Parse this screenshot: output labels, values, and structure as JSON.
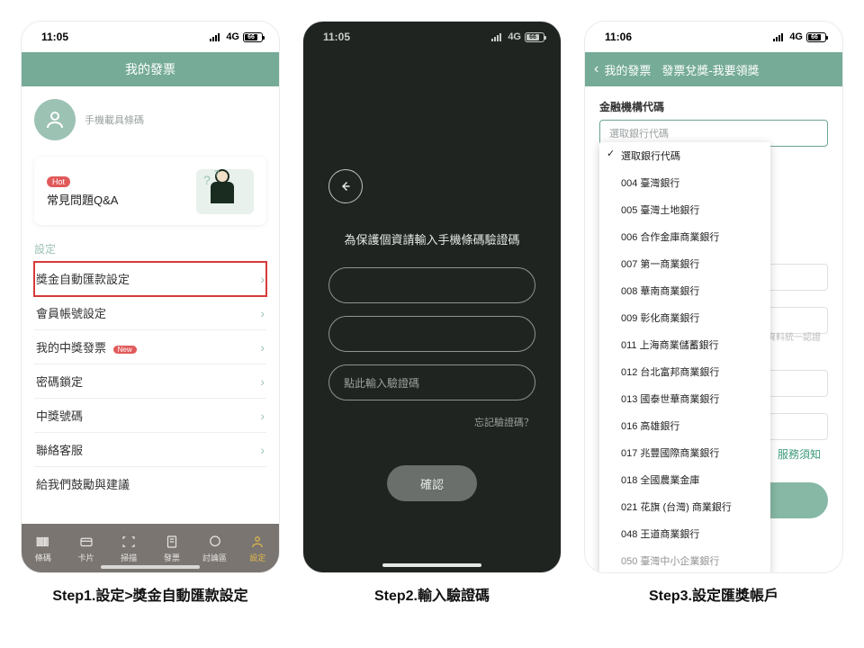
{
  "status": {
    "time1": "11:05",
    "time2": "11:05",
    "time3": "11:06",
    "net": "4G",
    "batt": "66"
  },
  "p1": {
    "header": "我的發票",
    "profile_label": "手機載具條碼",
    "hot": "Hot",
    "qa_title": "常見問題Q&A",
    "section": "設定",
    "rows": [
      "獎金自動匯款設定",
      "會員帳號設定",
      "我的中獎發票",
      "密碼鎖定",
      "中獎號碼",
      "聯絡客服",
      "給我們鼓勵與建議"
    ],
    "new": "New",
    "tabs": [
      "條碼",
      "卡片",
      "掃描",
      "發票",
      "討論區",
      "設定"
    ]
  },
  "p2": {
    "msg": "為保護個資請輸入手機條碼驗證碼",
    "field3_placeholder": "點此輸入驗證碼",
    "forgot": "忘記驗證碼？",
    "confirm": "確認"
  },
  "p3": {
    "back": "我的發票",
    "title": "發票兌獎-我要領獎",
    "label": "金融機構代碼",
    "select_placeholder": "選取銀行代碼",
    "options": [
      "選取銀行代碼",
      "004 臺灣銀行",
      "005 臺灣土地銀行",
      "006 合作金庫商業銀行",
      "007 第一商業銀行",
      "008 華南商業銀行",
      "009 彰化商業銀行",
      "011 上海商業儲蓄銀行",
      "012 台北富邦商業銀行",
      "013 國泰世華商業銀行",
      "016 高雄銀行",
      "017 兆豐國際商業銀行",
      "018 全國農業金庫",
      "021 花旗 (台灣) 商業銀行",
      "048 王道商業銀行",
      "050 臺灣中小企業銀行"
    ],
    "hint": "資料統一認證",
    "link": "服務須知"
  },
  "captions": {
    "s1": "Step1.設定>獎金自動匯款設定",
    "s2": "Step2.輸入驗證碼",
    "s3": "Step3.設定匯獎帳戶"
  }
}
